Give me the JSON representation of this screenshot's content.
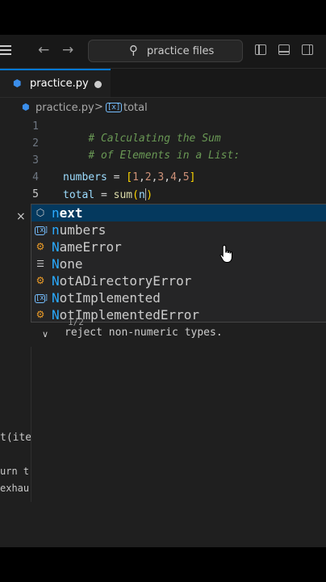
{
  "titlebar": {
    "search_placeholder": "practice files",
    "icons": [
      "menu-icon",
      "back-arrow-icon",
      "forward-arrow-icon",
      "search-icon",
      "toggle-primary-sidebar-icon",
      "toggle-panel-icon",
      "toggle-secondary-sidebar-icon"
    ]
  },
  "tab": {
    "label": "practice.py",
    "dirty": true
  },
  "breadcrumb": {
    "file": "practice.py",
    "separator": ">",
    "symbol": "total"
  },
  "editor": {
    "line_numbers": [
      "1",
      "2",
      "3",
      "4",
      "5"
    ],
    "lines": {
      "l1": "# Calculating the Sum",
      "l2": "# of Elements in a List:",
      "l4_var": "numbers",
      "l4_eq": " = ",
      "l4_open": "[",
      "l4_n1": "1",
      "l4_c1": ",",
      "l4_n2": "2",
      "l4_c2": ",",
      "l4_n3": "3",
      "l4_c3": ",",
      "l4_n4": "4",
      "l4_c4": ",",
      "l4_n5": "5",
      "l4_close": "]",
      "l5_var": "total",
      "l5_eq": " = ",
      "l5_fn": "sum",
      "l5_open": "(",
      "l5_arg": "n",
      "l5_close": ")"
    }
  },
  "left_fragments": {
    "close": "×",
    "f1": "t(ite",
    "f2": "urn t",
    "f3": "exhau"
  },
  "suggestions": [
    {
      "match": "n",
      "rest": "ext",
      "kind": "method",
      "icon": "method-cube-icon",
      "selected": true
    },
    {
      "match": "n",
      "rest": "umbers",
      "kind": "variable",
      "icon": "variable-icon",
      "selected": false
    },
    {
      "match": "N",
      "rest": "ameError",
      "kind": "class",
      "icon": "class-icon",
      "selected": false
    },
    {
      "match": "N",
      "rest": "one",
      "kind": "keyword",
      "icon": "keyword-icon",
      "selected": false
    },
    {
      "match": "N",
      "rest": "otADirectoryError",
      "kind": "class",
      "icon": "class-icon",
      "selected": false
    },
    {
      "match": "N",
      "rest": "otImplemented",
      "kind": "variable",
      "icon": "variable-icon",
      "selected": false
    },
    {
      "match": "N",
      "rest": "otImplementedError",
      "kind": "class",
      "icon": "class-icon",
      "selected": false
    }
  ],
  "detail": {
    "fragment": "1/2",
    "text": "reject non-numeric types."
  },
  "colors": {
    "editor_bg": "#1f1f1f",
    "accent": "#0078d4",
    "selection": "#04395e",
    "match_highlight": "#2aaaff"
  }
}
